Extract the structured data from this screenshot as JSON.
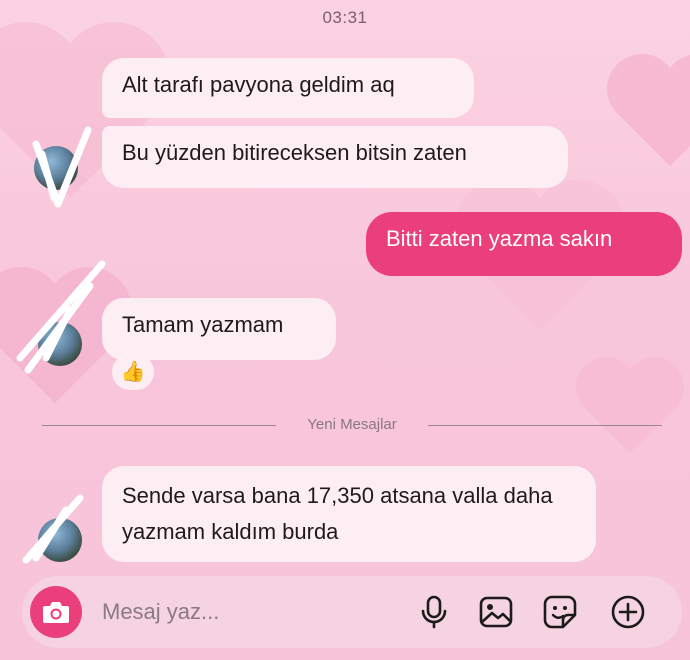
{
  "status": {
    "time": "03:31"
  },
  "messages": [
    {
      "direction": "incoming",
      "text": "Alt tarafı pavyona geldim aq"
    },
    {
      "direction": "incoming",
      "text": "Bu yüzden bitireceksen bitsin zaten"
    },
    {
      "direction": "outgoing",
      "text": "Bitti zaten yazma sakın"
    },
    {
      "direction": "incoming",
      "text": "Tamam yazmam",
      "reaction": "👍"
    },
    {
      "direction": "incoming",
      "text": "Sende varsa bana 17,350 atsana valla daha yazmam kaldım burda"
    }
  ],
  "divider": {
    "label": "Yeni Mesajlar"
  },
  "composer": {
    "placeholder": "Mesaj yaz...",
    "icons": [
      "camera-icon",
      "microphone-icon",
      "gallery-icon",
      "sticker-icon",
      "plus-icon"
    ]
  },
  "colors": {
    "accent": "#ea3f7a",
    "incoming_bubble": "#fdeef4",
    "background": "#f8c6da"
  }
}
